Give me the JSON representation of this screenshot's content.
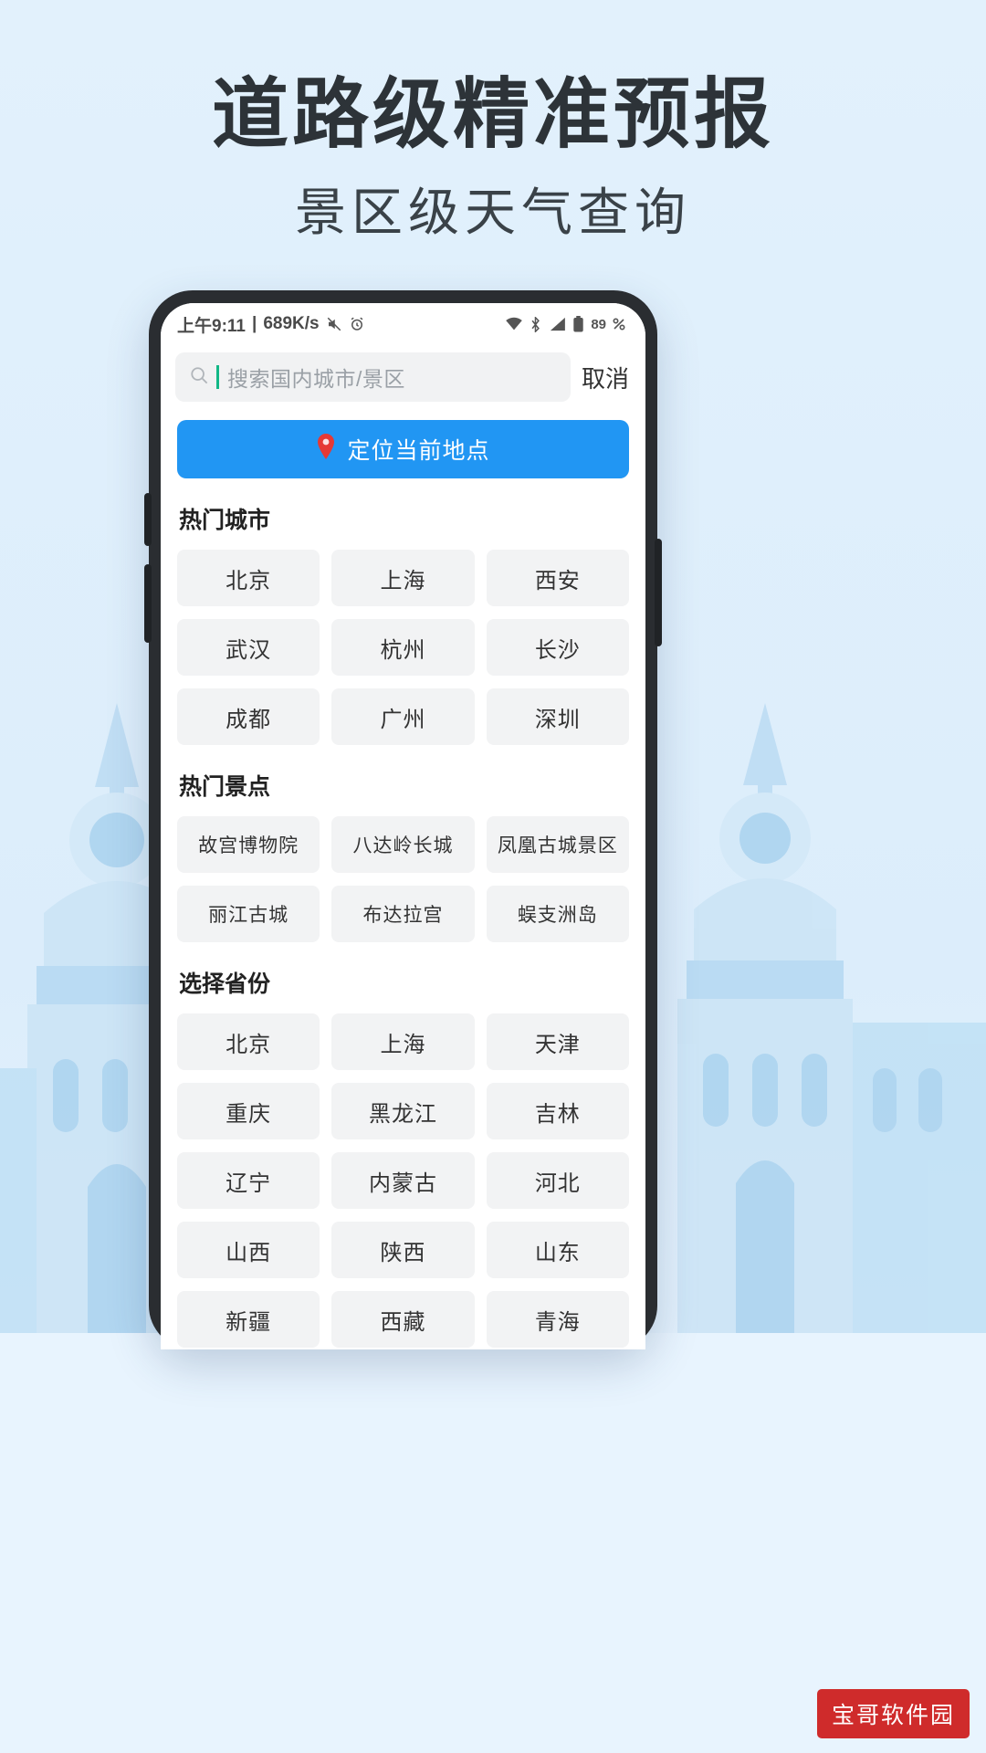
{
  "promo": {
    "headline": "道路级精准预报",
    "subheadline": "景区级天气查询",
    "bg_color": "#e4f2fc",
    "accent_color": "#2196f3"
  },
  "statusbar": {
    "time": "上午9:11",
    "separator": "|",
    "network_speed": "689K/s",
    "mute_icon": "mute-icon",
    "alarm_icon": "alarm-icon",
    "wifi_icon": "wifi-icon",
    "bluetooth_icon": "bluetooth-icon",
    "signal_icon": "signal-icon",
    "battery_icon": "battery-icon",
    "battery_level": "89"
  },
  "search": {
    "icon": "search-icon",
    "placeholder": "搜索国内城市/景区",
    "value": "",
    "cancel_label": "取消",
    "caret_color": "#12b886"
  },
  "locate": {
    "icon": "location-pin-icon",
    "label": "定位当前地点",
    "bg_color": "#2196f3",
    "pin_color": "#e53935"
  },
  "sections": [
    {
      "title": "热门城市",
      "items": [
        "北京",
        "上海",
        "西安",
        "武汉",
        "杭州",
        "长沙",
        "成都",
        "广州",
        "深圳"
      ]
    },
    {
      "title": "热门景点",
      "items": [
        "故宫博物院",
        "八达岭长城",
        "凤凰古城景区",
        "丽江古城",
        "布达拉宫",
        "蜈支洲岛"
      ]
    },
    {
      "title": "选择省份",
      "items": [
        "北京",
        "上海",
        "天津",
        "重庆",
        "黑龙江",
        "吉林",
        "辽宁",
        "内蒙古",
        "河北",
        "山西",
        "陕西",
        "山东",
        "新疆",
        "西藏",
        "青海"
      ]
    }
  ],
  "watermark": {
    "label": "宝哥软件园",
    "bg_color": "#cf2b2b"
  }
}
